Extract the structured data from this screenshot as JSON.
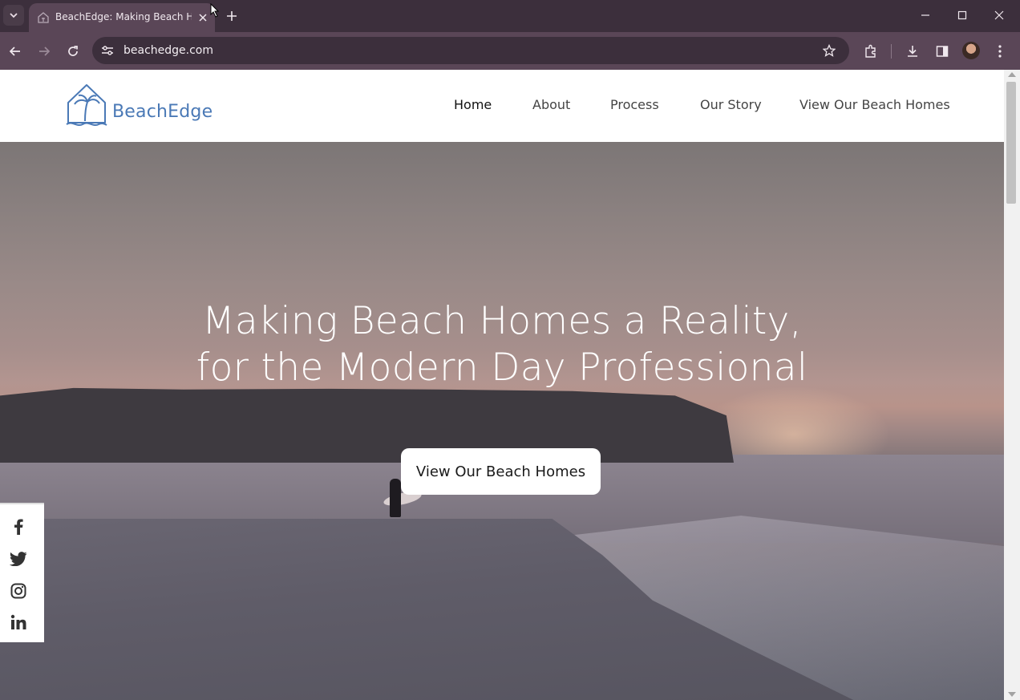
{
  "browser": {
    "tab_title": "BeachEdge: Making Beach Homes a Reality",
    "url": "beachedge.com"
  },
  "site": {
    "logo_text": "BeachEdge",
    "nav": [
      "Home",
      "About",
      "Process",
      "Our Story",
      "View Our Beach Homes"
    ],
    "active_nav": "Home"
  },
  "hero": {
    "title_line1": "Making Beach Homes a Reality,",
    "title_line2": "for the Modern Day Professional",
    "cta_label": "View Our Beach Homes"
  },
  "social": [
    "facebook-icon",
    "twitter-icon",
    "instagram-icon",
    "linkedin-icon"
  ],
  "colors": {
    "brand": "#4a79b6",
    "tabbar": "#3c2f3c",
    "toolbar": "#5a4657"
  }
}
